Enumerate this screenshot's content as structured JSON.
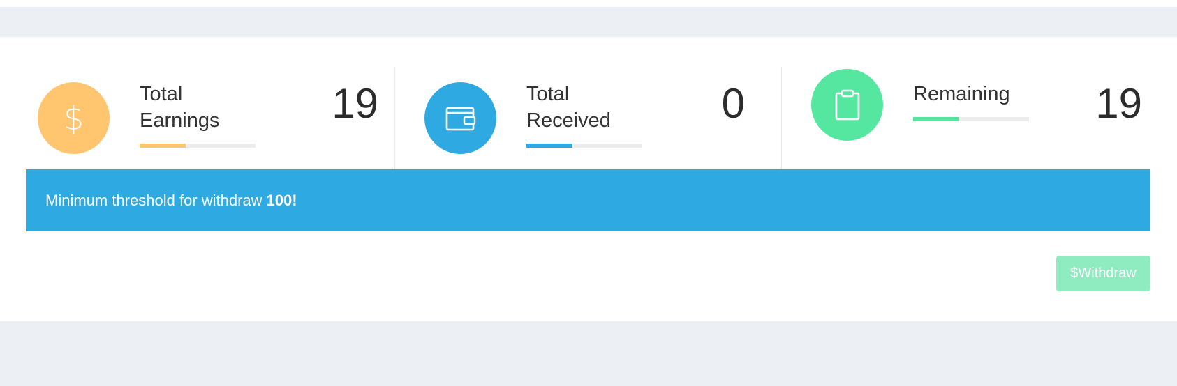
{
  "stats": [
    {
      "label": "Total\nEarnings",
      "value": "19",
      "color": "#ffc56f",
      "icon": "dollar-icon",
      "progress": 0.4
    },
    {
      "label": "Total\nReceived",
      "value": "0",
      "color": "#2fa9e1",
      "icon": "wallet-icon",
      "progress": 0.4
    },
    {
      "label": "Remaining",
      "value": "19",
      "color": "#55e69f",
      "icon": "clipboard-icon",
      "progress": 0.4
    }
  ],
  "alert": {
    "text": "Minimum threshold for withdraw",
    "amount": "100!",
    "color": "#2fa9e1"
  },
  "withdraw": {
    "label": "$Withdraw",
    "color": "#8fecc0"
  }
}
